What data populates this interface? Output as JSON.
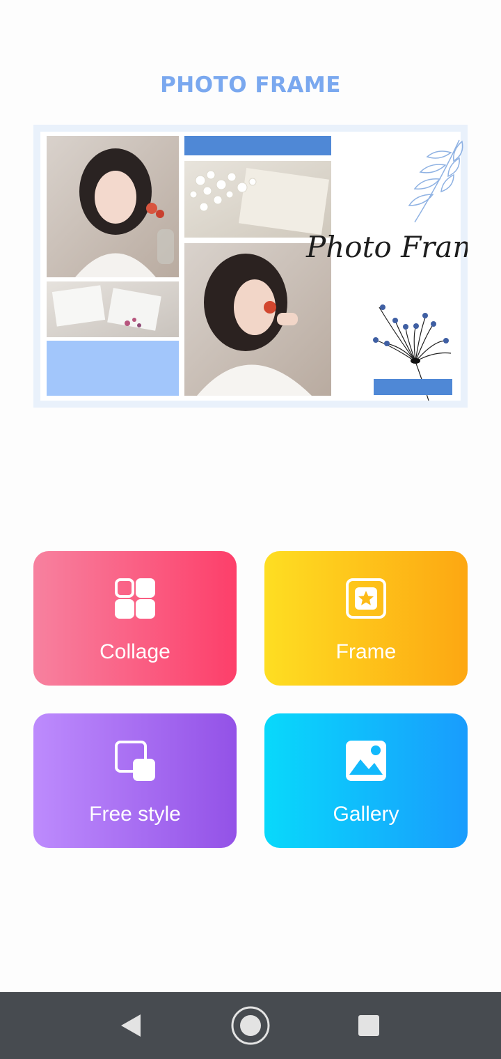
{
  "header": {
    "title": "PHOTO FRAME"
  },
  "banner": {
    "script_text": "Photo Frame"
  },
  "actions": [
    {
      "id": "collage",
      "label": "Collage",
      "icon": "grid-icon"
    },
    {
      "id": "frame",
      "label": "Frame",
      "icon": "star-frame-icon"
    },
    {
      "id": "free_style",
      "label": "Free style",
      "icon": "layers-icon"
    },
    {
      "id": "gallery",
      "label": "Gallery",
      "icon": "image-icon"
    }
  ],
  "colors": {
    "title": "#7aa8ef",
    "collage": [
      "#f7819f",
      "#fd3f6a"
    ],
    "frame": [
      "#fede22",
      "#fda712"
    ],
    "free_style": [
      "#bd8bfd",
      "#9352e7"
    ],
    "gallery": [
      "#08d9fb",
      "#199cfd"
    ],
    "navbar": "#474b50"
  },
  "navigation_bar": {
    "back": "back-icon",
    "home": "home-icon",
    "recents": "recents-icon"
  }
}
